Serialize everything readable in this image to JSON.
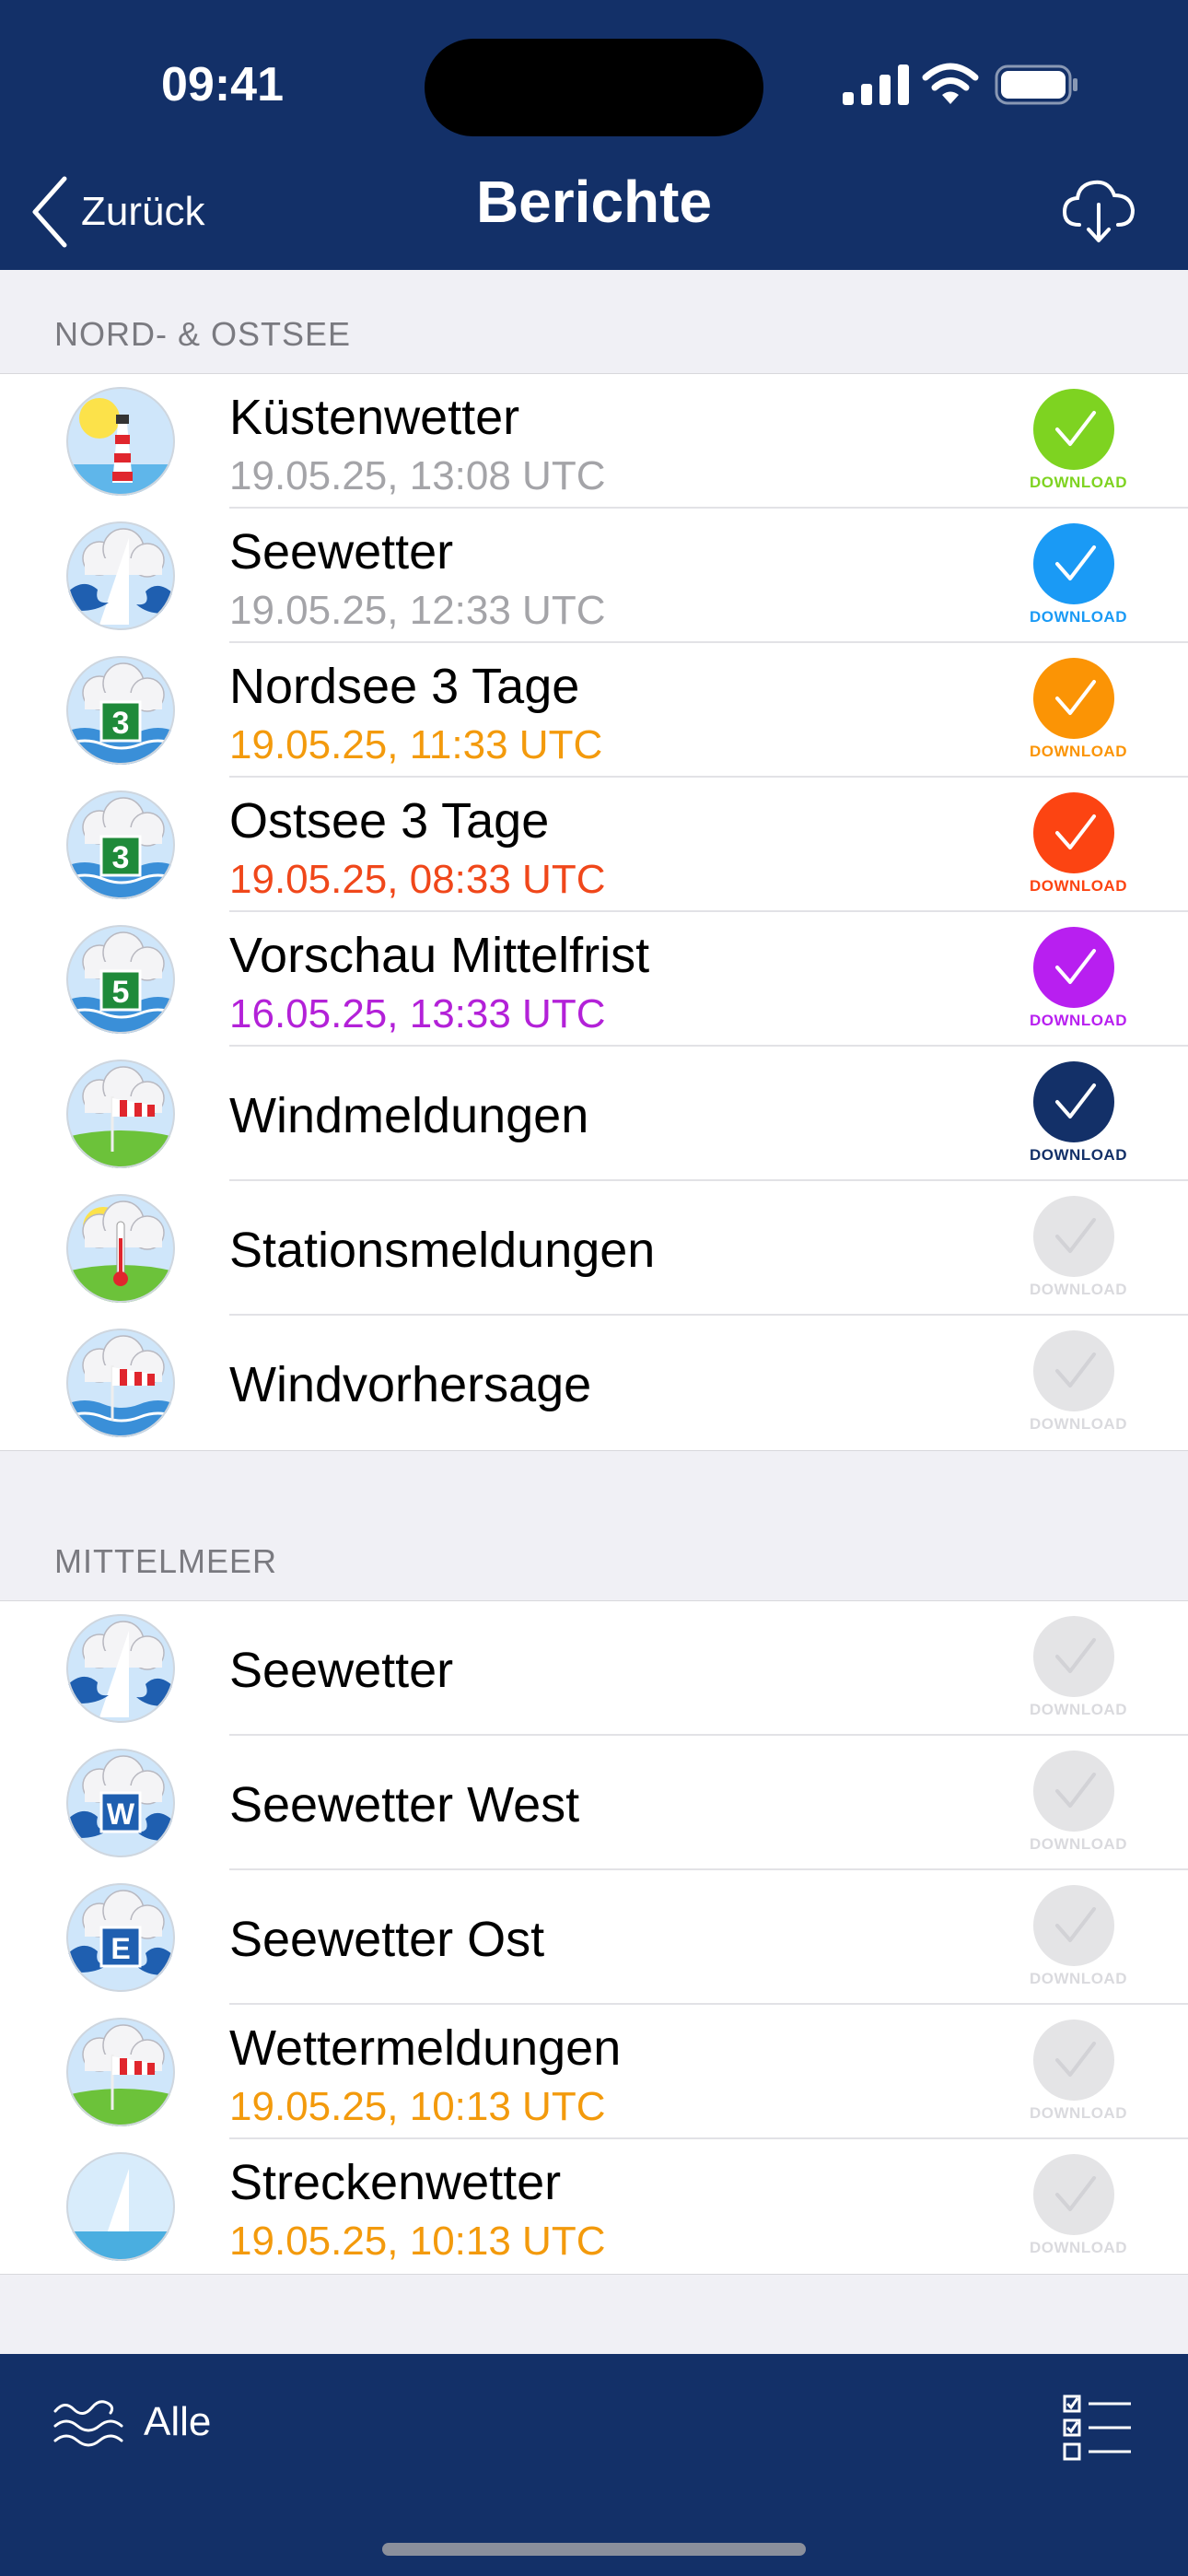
{
  "status_bar": {
    "time": "09:41"
  },
  "nav": {
    "back_label": "Zurück",
    "title": "Berichte"
  },
  "sections": [
    {
      "header": "NORD- & OSTSEE",
      "items": [
        {
          "title": "Küstenwetter",
          "subtitle": "19.05.25, 13:08 UTC",
          "subtitle_color": "#a4a4a8",
          "icon": "lighthouse-icon",
          "download_label": "DOWNLOAD",
          "download_color": "#7ed321",
          "downloaded": true
        },
        {
          "title": "Seewetter",
          "subtitle": "19.05.25, 12:33 UTC",
          "subtitle_color": "#a4a4a8",
          "icon": "sailboat-icon",
          "download_label": "DOWNLOAD",
          "download_color": "#1a9af5",
          "downloaded": true
        },
        {
          "title": "Nordsee 3 Tage",
          "subtitle": "19.05.25, 11:33 UTC",
          "subtitle_color": "#f39a0c",
          "icon": "forecast-3-icon",
          "download_label": "DOWNLOAD",
          "download_color": "#fb9405",
          "downloaded": true
        },
        {
          "title": "Ostsee 3 Tage",
          "subtitle": "19.05.25, 08:33 UTC",
          "subtitle_color": "#f0471a",
          "icon": "forecast-3-icon",
          "download_label": "DOWNLOAD",
          "download_color": "#fc4412",
          "downloaded": true
        },
        {
          "title": "Vorschau Mittelfrist",
          "subtitle": "16.05.25, 13:33 UTC",
          "subtitle_color": "#b321d8",
          "icon": "forecast-5-icon",
          "download_label": "DOWNLOAD",
          "download_color": "#b81ff0",
          "downloaded": true
        },
        {
          "title": "Windmeldungen",
          "subtitle": "",
          "icon": "windsock-icon",
          "download_label": "DOWNLOAD",
          "download_color": "#133068",
          "downloaded": true
        },
        {
          "title": "Stationsmeldungen",
          "subtitle": "",
          "icon": "thermometer-icon",
          "download_label": "DOWNLOAD",
          "download_color": "#e4e4e6",
          "downloaded": false
        },
        {
          "title": "Windvorhersage",
          "subtitle": "",
          "icon": "windsock-sea-icon",
          "download_label": "DOWNLOAD",
          "download_color": "#e4e4e6",
          "downloaded": false
        }
      ]
    },
    {
      "header": "MITTELMEER",
      "items": [
        {
          "title": "Seewetter",
          "subtitle": "",
          "icon": "sailboat-icon",
          "download_label": "DOWNLOAD",
          "download_color": "#e4e4e6",
          "downloaded": false
        },
        {
          "title": "Seewetter West",
          "subtitle": "",
          "icon": "sea-west-icon",
          "download_label": "DOWNLOAD",
          "download_color": "#e4e4e6",
          "downloaded": false
        },
        {
          "title": "Seewetter Ost",
          "subtitle": "",
          "icon": "sea-east-icon",
          "download_label": "DOWNLOAD",
          "download_color": "#e4e4e6",
          "downloaded": false
        },
        {
          "title": "Wettermeldungen",
          "subtitle": "19.05.25, 10:13 UTC",
          "subtitle_color": "#f39a0c",
          "icon": "windsock-icon",
          "download_label": "DOWNLOAD",
          "download_color": "#e4e4e6",
          "downloaded": false
        },
        {
          "title": "Streckenwetter",
          "subtitle": "19.05.25, 10:13 UTC",
          "subtitle_color": "#f39a0c",
          "icon": "sailboat-route-icon",
          "download_label": "DOWNLOAD",
          "download_color": "#e4e4e6",
          "downloaded": false
        }
      ]
    }
  ],
  "tab_bar": {
    "filter_label": "Alle"
  },
  "colors": {
    "navy": "#133068",
    "inactive_download": "#e4e4e6",
    "inactive_label": "#dadade"
  }
}
